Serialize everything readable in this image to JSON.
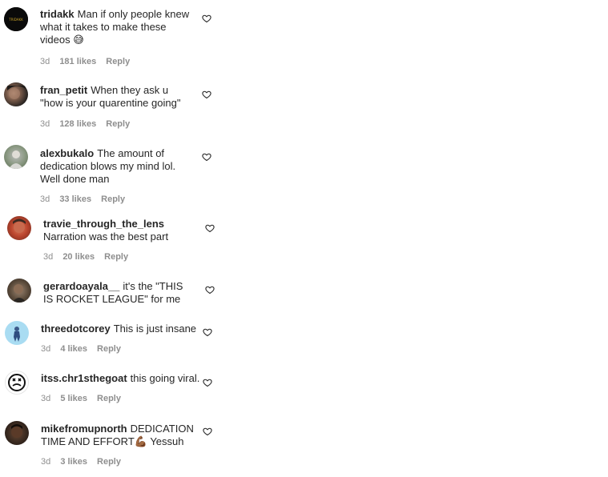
{
  "comments": [
    {
      "username": "tridakk",
      "text": "Man if only people knew what it takes to make these videos 😅",
      "time": "3d",
      "likes": "181 likes",
      "reply": "Reply",
      "avatar_label": "TRIDAKK"
    },
    {
      "username": "fran_petit",
      "text": "When they ask u \"how is your quarentine going\"",
      "time": "3d",
      "likes": "128 likes",
      "reply": "Reply"
    },
    {
      "username": "alexbukalo",
      "text": "The amount of dedication blows my mind lol. Well done man",
      "time": "3d",
      "likes": "33 likes",
      "reply": "Reply"
    },
    {
      "username": "travie_through_the_lens",
      "text": "Narration was the best part",
      "time": "3d",
      "likes": "20 likes",
      "reply": "Reply"
    },
    {
      "username": "gerardoayala__",
      "text": "it's the \"THIS IS ROCKET LEAGUE\" for me",
      "time": "",
      "likes": "",
      "reply": ""
    },
    {
      "username": "threedotcorey",
      "text": "This is just insane",
      "time": "3d",
      "likes": "4 likes",
      "reply": "Reply"
    },
    {
      "username": "itss.chr1sthegoat",
      "text": "this going viral.",
      "time": "3d",
      "likes": "5 likes",
      "reply": "Reply"
    },
    {
      "username": "mikefromupnorth",
      "text": "DEDICATION TIME AND EFFORT💪🏾 Yessuh",
      "time": "3d",
      "likes": "3 likes",
      "reply": "Reply"
    }
  ]
}
